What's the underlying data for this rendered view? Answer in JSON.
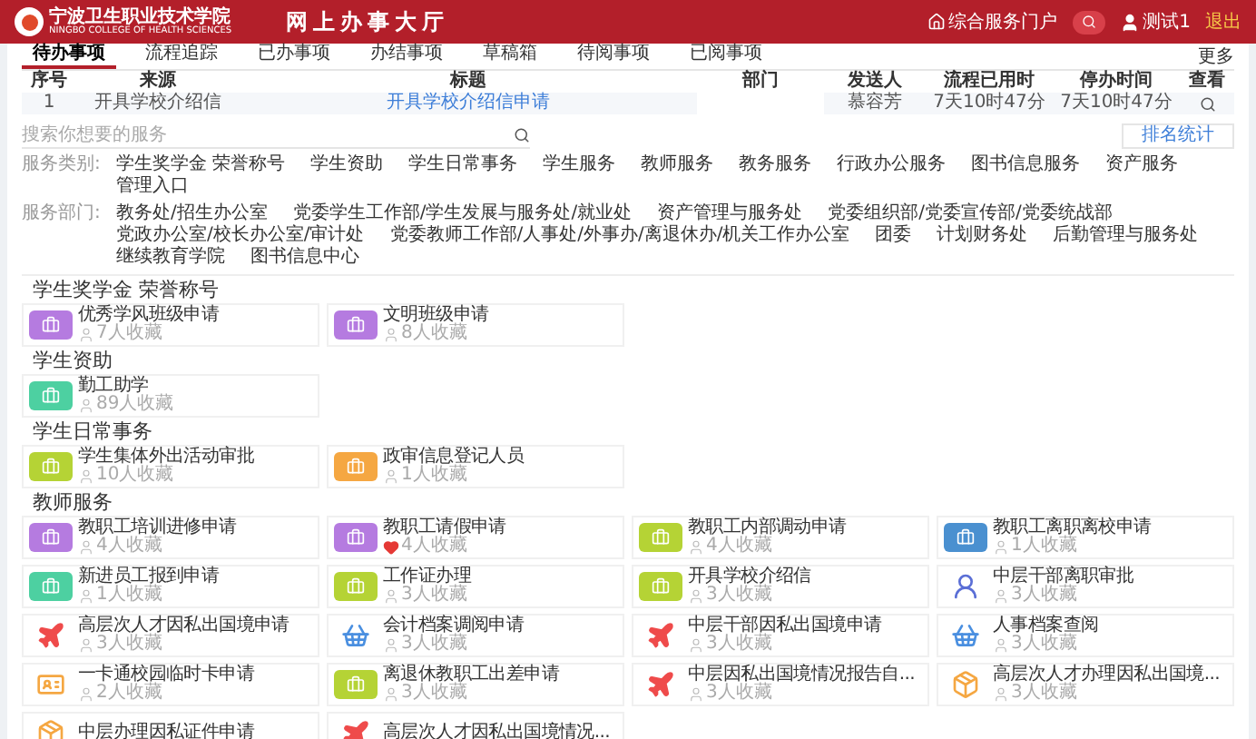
{
  "header": {
    "school_name": "宁波卫生职业技术学院",
    "school_name_en": "NINGBO COLLEGE OF HEALTH SCIENCES",
    "title": "网上办事大厅",
    "portal_link": "综合服务门户",
    "user_name": "测试1",
    "logout": "退出"
  },
  "tabs": [
    {
      "label": "待办事项",
      "selected": true
    },
    {
      "label": "流程追踪",
      "selected": false
    },
    {
      "label": "已办事项",
      "selected": false
    },
    {
      "label": "办结事项",
      "selected": false
    },
    {
      "label": "草稿箱",
      "selected": false
    },
    {
      "label": "待阅事项",
      "selected": false
    },
    {
      "label": "已阅事项",
      "selected": false
    }
  ],
  "more": "更多",
  "table": {
    "columns": [
      "序号",
      "来源",
      "标题",
      "部门",
      "发送人",
      "流程已用时",
      "停办时间",
      "查看"
    ],
    "rows": [
      {
        "cells": [
          "1",
          "开具学校介绍信",
          "开具学校介绍信申请",
          "",
          "慕容芳",
          "7天10时47分",
          "7天10时47分"
        ]
      }
    ]
  },
  "search": {
    "placeholder": "搜索你想要的服务",
    "button": "排名统计"
  },
  "filters": [
    {
      "label": "服务类别:",
      "items": [
        "学生奖学金 荣誉称号",
        "学生资助",
        "学生日常事务",
        "学生服务",
        "教师服务",
        "教务服务",
        "行政办公服务",
        "图书信息服务",
        "资产服务",
        "管理入口"
      ]
    },
    {
      "label": "服务部门:",
      "items": [
        "教务处/招生办公室",
        "党委学生工作部/学生发展与服务处/就业处",
        "资产管理与服务处",
        "党委组织部/党委宣传部/党委统战部",
        "党政办公室/校长办公室/审计处",
        "党委教师工作部/人事处/外事办/离退休办/机关工作办公室",
        "团委",
        "计划财务处",
        "后勤管理与服务处",
        "继续教育学院",
        "图书信息中心"
      ]
    }
  ],
  "sections": [
    {
      "title": "学生奖学金 荣誉称号",
      "services": [
        {
          "name": "优秀学风班级申请",
          "count": "7人收藏",
          "kind": "tile",
          "color": "#b57be0",
          "favorite": false
        },
        {
          "name": "文明班级申请",
          "count": "8人收藏",
          "kind": "tile",
          "color": "#b57be0",
          "favorite": false
        }
      ]
    },
    {
      "title": "学生资助",
      "services": [
        {
          "name": "勤工助学",
          "count": "89人收藏",
          "kind": "tile",
          "color": "#4dd0a1",
          "favorite": false
        }
      ]
    },
    {
      "title": "学生日常事务",
      "services": [
        {
          "name": "学生集体外出活动审批",
          "count": "10人收藏",
          "kind": "tile",
          "color": "#b5d335",
          "favorite": false
        },
        {
          "name": "政审信息登记人员",
          "count": "1人收藏",
          "kind": "tile",
          "color": "#f5a742",
          "favorite": false
        }
      ]
    },
    {
      "title": "教师服务",
      "services": [
        {
          "name": "教职工培训进修申请",
          "count": "4人收藏",
          "kind": "tile",
          "color": "#b57be0",
          "favorite": false
        },
        {
          "name": "教职工请假申请",
          "count": "4人收藏",
          "kind": "tile",
          "color": "#b57be0",
          "favorite": true
        },
        {
          "name": "教职工内部调动申请",
          "count": "4人收藏",
          "kind": "tile",
          "color": "#b5d335",
          "favorite": false
        },
        {
          "name": "教职工离职离校申请",
          "count": "1人收藏",
          "kind": "tile",
          "color": "#4a90d0",
          "favorite": false
        },
        {
          "name": "新进员工报到申请",
          "count": "1人收藏",
          "kind": "tile",
          "color": "#4dd0a1",
          "favorite": false
        },
        {
          "name": "工作证办理",
          "count": "3人收藏",
          "kind": "tile",
          "color": "#b5d335",
          "favorite": false
        },
        {
          "name": "开具学校介绍信",
          "count": "3人收藏",
          "kind": "tile",
          "color": "#b5d335",
          "favorite": false
        },
        {
          "name": "中层干部离职审批",
          "count": "3人收藏",
          "kind": "person",
          "color": "#5b6fd6",
          "favorite": false
        },
        {
          "name": "高层次人才因私出国境申请",
          "count": "3人收藏",
          "kind": "plane",
          "color": "#ef4b4b",
          "favorite": false
        },
        {
          "name": "会计档案调阅申请",
          "count": "3人收藏",
          "kind": "basket",
          "color": "#4a8fe0",
          "favorite": false
        },
        {
          "name": "中层干部因私出国境申请",
          "count": "3人收藏",
          "kind": "plane",
          "color": "#ef4b4b",
          "favorite": false
        },
        {
          "name": "人事档案查阅",
          "count": "3人收藏",
          "kind": "basket",
          "color": "#4a8fe0",
          "favorite": false
        },
        {
          "name": "一卡通校园临时卡申请",
          "count": "2人收藏",
          "kind": "card",
          "color": "#f5a742",
          "favorite": false
        },
        {
          "name": "离退休教职工出差申请",
          "count": "3人收藏",
          "kind": "tile",
          "color": "#b5d335",
          "favorite": false
        },
        {
          "name": "中层因私出国境情况报告自...",
          "count": "3人收藏",
          "kind": "plane",
          "color": "#ef4b4b",
          "favorite": false
        },
        {
          "name": "高层次人才办理因私出国境...",
          "count": "3人收藏",
          "kind": "box",
          "color": "#f5a742",
          "favorite": false
        },
        {
          "name": "中层办理因私证件申请",
          "kind": "box",
          "color": "#f5a742"
        },
        {
          "name": "高层次人才因私出国境情况...",
          "kind": "plane",
          "color": "#ef4b4b"
        }
      ]
    }
  ]
}
